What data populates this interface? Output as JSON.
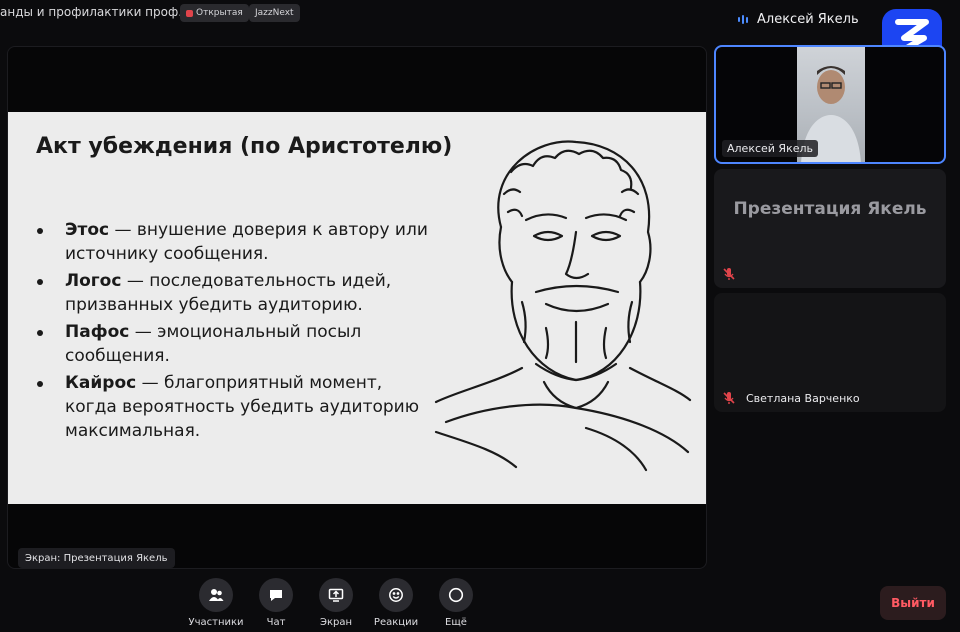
{
  "meeting": {
    "title": "анды и профилактики проф…",
    "badges": [
      "Открытая",
      "JazzNext"
    ],
    "active_speaker": "Алексей Якель"
  },
  "slide": {
    "title": "Акт убеждения (по Аристотелю)",
    "bullets": [
      {
        "term": "Этос",
        "text": " — внушение доверия к автору или источнику сообщения."
      },
      {
        "term": "Логос",
        "text": " — последовательность идей, призванных убедить аудиторию."
      },
      {
        "term": "Пафос",
        "text": " — эмоциональный посыл сообщения."
      },
      {
        "term": "Кайрос",
        "text": " — благоприятный момент, когда вероятность убедить аудиторию максимальная."
      }
    ]
  },
  "screen_label": "Экран: Презентация Якель",
  "participants": [
    {
      "name": "Алексей Якель",
      "video": true,
      "muted": false
    },
    {
      "name": "Презентация Якель",
      "video": false,
      "muted": true
    },
    {
      "name": "Светлана Варченко",
      "video": false,
      "muted": true
    }
  ],
  "controls": [
    {
      "label": "Участники",
      "icon": "participants-icon"
    },
    {
      "label": "Чат",
      "icon": "chat-icon"
    },
    {
      "label": "Экран",
      "icon": "share-screen-icon"
    },
    {
      "label": "Реакции",
      "icon": "reactions-icon"
    },
    {
      "label": "Ещё",
      "icon": "more-icon"
    }
  ],
  "leave_label": "Выйти",
  "colors": {
    "accent": "#4e86ff",
    "logo": "#1c45f2",
    "leave": "#ff5a63",
    "muted": "#e0444b"
  }
}
